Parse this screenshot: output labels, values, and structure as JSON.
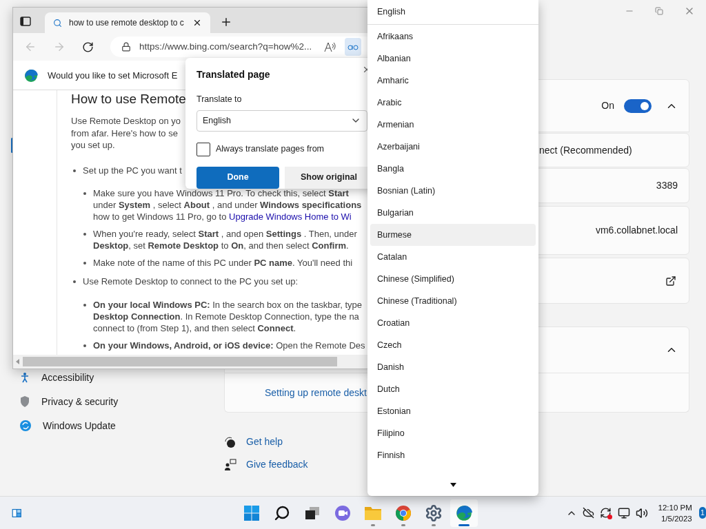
{
  "settings": {
    "sidebar": {
      "items": [
        {
          "label": "Accessibility"
        },
        {
          "label": "Privacy & security"
        },
        {
          "label": "Windows Update"
        }
      ]
    },
    "remote_desktop": {
      "state_label": "On",
      "on": true,
      "expanded": true
    },
    "rows": [
      {
        "kind": "label",
        "text": "nect (Recommended)"
      },
      {
        "kind": "value",
        "text": "3389"
      },
      {
        "kind": "value",
        "text": "vm6.collabnet.local"
      },
      {
        "kind": "external"
      }
    ],
    "related": {
      "expanded": true,
      "link": "Setting up remote deskt"
    },
    "help_links": [
      "Get help",
      "Give feedback"
    ]
  },
  "browser": {
    "tab": {
      "title": "how to use remote desktop to c"
    },
    "nav": {
      "back_disabled": true,
      "forward_disabled": true
    },
    "address": "https://www.bing.com/search?q=how%2...",
    "infobar": "Would you like to set Microsoft E",
    "article": {
      "heading": "How to use Remote",
      "intro_lines": [
        "Use Remote Desktop on yo",
        "from afar. Here's how to se",
        "you set up."
      ],
      "sections": [
        {
          "text": "Set up the PC you want t",
          "children": [
            {
              "lines": [
                "Make sure you have Windows 11 Pro. To check this, select **Start**",
                "under **System** , select **About** , and under **Windows specifications**",
                "how to get Windows 11 Pro, go to "
              ],
              "link": "Upgrade Windows Home to Wi"
            },
            {
              "lines": [
                "When you're ready, select **Start** , and open **Settings** . Then, under",
                "**Desktop**, set **Remote Desktop** to **On**, and then select **Confirm**."
              ]
            },
            {
              "lines": [
                "Make note of the name of this PC under **PC name**. You'll need thi"
              ]
            }
          ]
        },
        {
          "text": "Use Remote Desktop to connect to the PC you set up:",
          "children": [
            {
              "lines": [
                "**On your local Windows PC:** In the search box on the taskbar, type",
                "**Desktop Connection**. In Remote Desktop Connection, type the na",
                "connect to (from Step 1), and then select **Connect**."
              ]
            },
            {
              "lines": [
                "**On your Windows, Android, or iOS device:** Open the Remote Des"
              ]
            }
          ]
        }
      ]
    }
  },
  "translate_popup": {
    "title": "Translated page",
    "label": "Translate to",
    "select": "English",
    "always_translate": {
      "label": "Always translate pages from",
      "checked": false
    },
    "buttons": [
      {
        "label": "Done",
        "primary": true
      },
      {
        "label": "Show original",
        "primary": false
      }
    ]
  },
  "language_list": {
    "current": "English",
    "options": [
      {
        "label": "Afrikaans",
        "hovered": false
      },
      {
        "label": "Albanian",
        "hovered": false
      },
      {
        "label": "Amharic",
        "hovered": false
      },
      {
        "label": "Arabic",
        "hovered": false
      },
      {
        "label": "Armenian",
        "hovered": false
      },
      {
        "label": "Azerbaijani",
        "hovered": false
      },
      {
        "label": "Bangla",
        "hovered": false
      },
      {
        "label": "Bosnian (Latin)",
        "hovered": false
      },
      {
        "label": "Bulgarian",
        "hovered": false
      },
      {
        "label": "Burmese",
        "hovered": true
      },
      {
        "label": "Catalan",
        "hovered": false
      },
      {
        "label": "Chinese (Simplified)",
        "hovered": false
      },
      {
        "label": "Chinese (Traditional)",
        "hovered": false
      },
      {
        "label": "Croatian",
        "hovered": false
      },
      {
        "label": "Czech",
        "hovered": false
      },
      {
        "label": "Danish",
        "hovered": false
      },
      {
        "label": "Dutch",
        "hovered": false
      },
      {
        "label": "Estonian",
        "hovered": false
      },
      {
        "label": "Filipino",
        "hovered": false
      },
      {
        "label": "Finnish",
        "hovered": false
      }
    ]
  },
  "taskbar": {
    "apps": [
      {
        "kind": "start",
        "running": false,
        "active": false
      },
      {
        "kind": "search",
        "running": false,
        "active": false
      },
      {
        "kind": "taskview",
        "running": false,
        "active": false
      },
      {
        "kind": "chat",
        "running": false,
        "active": false
      },
      {
        "kind": "explorer",
        "running": true,
        "active": false
      },
      {
        "kind": "chrome",
        "running": true,
        "active": false
      },
      {
        "kind": "settings",
        "running": true,
        "active": false
      },
      {
        "kind": "edge",
        "running": true,
        "active": true
      }
    ],
    "clock": {
      "time": "12:10 PM",
      "date": "1/5/2023"
    },
    "notification_count": "1"
  }
}
